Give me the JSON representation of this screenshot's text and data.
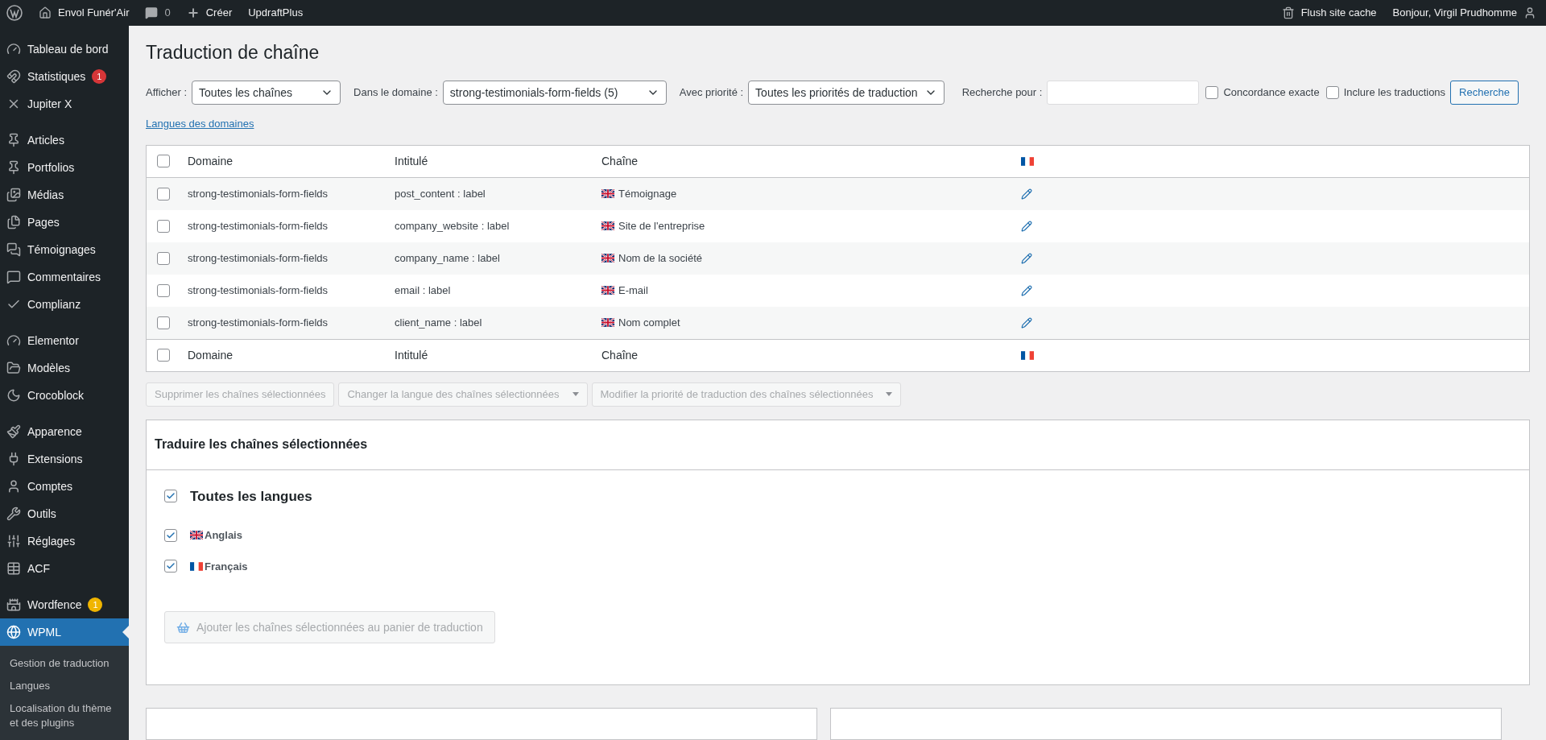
{
  "admin_bar": {
    "site_name": "Envol Funér'Air",
    "comments_count": "0",
    "new_label": "Créer",
    "plugin_label": "UpdraftPlus",
    "flush_label": "Flush site cache",
    "greeting": "Bonjour, Virgil Prudhomme"
  },
  "sidebar": {
    "groups": [
      [
        {
          "label": "Tableau de bord",
          "selected": false
        },
        {
          "label": "Statistiques",
          "selected": false,
          "badge": "1",
          "color": "#d63638"
        },
        {
          "label": "Jupiter X",
          "selected": false
        }
      ],
      [
        {
          "label": "Articles",
          "selected": false
        },
        {
          "label": "Portfolios",
          "selected": false
        },
        {
          "label": "Médias",
          "selected": false
        },
        {
          "label": "Pages",
          "selected": false
        },
        {
          "label": "Témoignages",
          "selected": false
        },
        {
          "label": "Commentaires",
          "selected": false
        },
        {
          "label": "Complianz",
          "selected": false
        }
      ],
      [
        {
          "label": "Elementor",
          "selected": false
        },
        {
          "label": "Modèles",
          "selected": false
        },
        {
          "label": "Crocoblock",
          "selected": false
        }
      ],
      [
        {
          "label": "Apparence",
          "selected": false
        },
        {
          "label": "Extensions",
          "selected": false
        },
        {
          "label": "Comptes",
          "selected": false
        },
        {
          "label": "Outils",
          "selected": false
        },
        {
          "label": "Réglages",
          "selected": false
        },
        {
          "label": "ACF",
          "selected": false
        }
      ],
      [
        {
          "label": "Wordfence",
          "selected": false,
          "badge": "1",
          "color": "#f0b500"
        },
        {
          "label": "WPML",
          "selected": true
        }
      ]
    ],
    "submenu": [
      {
        "label": "Gestion de traduction"
      },
      {
        "label": "Langues"
      },
      {
        "label": "Localisation du thème et des plugins"
      }
    ]
  },
  "page_title": "Traduction de chaîne",
  "filters": [
    {
      "label": "Afficher :",
      "value": "Toutes les chaînes"
    },
    {
      "label": "Dans le domaine :",
      "value": "strong-testimonials-form-fields (5)"
    },
    {
      "label": "Avec priorité :",
      "value": "Toutes les priorités de traduction"
    }
  ],
  "search": {
    "label": "Recherche pour :"
  },
  "search_options": [
    {
      "label": "Concordance exacte",
      "checked": false
    },
    {
      "label": "Inclure les traductions",
      "checked": false
    }
  ],
  "search_button": "Recherche",
  "domain_languages_link": "Langues des domaines",
  "table": {
    "select_all_checked": false,
    "columns": [
      "Domaine",
      "Intitulé",
      "Chaîne"
    ],
    "rows": [
      {
        "domain": "strong-testimonials-form-fields",
        "name": "post_content : label",
        "string": "Témoignage",
        "checked": false
      },
      {
        "domain": "strong-testimonials-form-fields",
        "name": "company_website : label",
        "string": "Site de l'entreprise",
        "checked": false
      },
      {
        "domain": "strong-testimonials-form-fields",
        "name": "company_name : label",
        "string": "Nom de la société",
        "checked": false
      },
      {
        "domain": "strong-testimonials-form-fields",
        "name": "email : label",
        "string": "E-mail",
        "checked": false
      },
      {
        "domain": "strong-testimonials-form-fields",
        "name": "client_name : label",
        "string": "Nom complet",
        "checked": false
      }
    ],
    "footer_columns": [
      "Domaine",
      "Intitulé",
      "Chaîne"
    ],
    "footer_select_all_checked": false
  },
  "bulk_actions": [
    {
      "kind": "button",
      "label": "Supprimer les chaînes sélectionnées",
      "disabled": true
    },
    {
      "kind": "select",
      "label": "Changer la langue des chaînes sélectionnées",
      "disabled": true
    },
    {
      "kind": "select",
      "label": "Modifier la priorité de traduction des chaînes sélectionnées",
      "disabled": true
    }
  ],
  "translate_panel": {
    "title": "Traduire les chaînes sélectionnées",
    "all_languages": {
      "label": "Toutes les langues",
      "checked": true
    },
    "languages": [
      {
        "kind": "uk",
        "label": "Anglais",
        "checked": true
      },
      {
        "kind": "fr",
        "label": "Français",
        "checked": true
      }
    ],
    "add_button": {
      "label": "Ajouter les chaînes sélectionnées au panier de traduction",
      "disabled": true
    }
  }
}
